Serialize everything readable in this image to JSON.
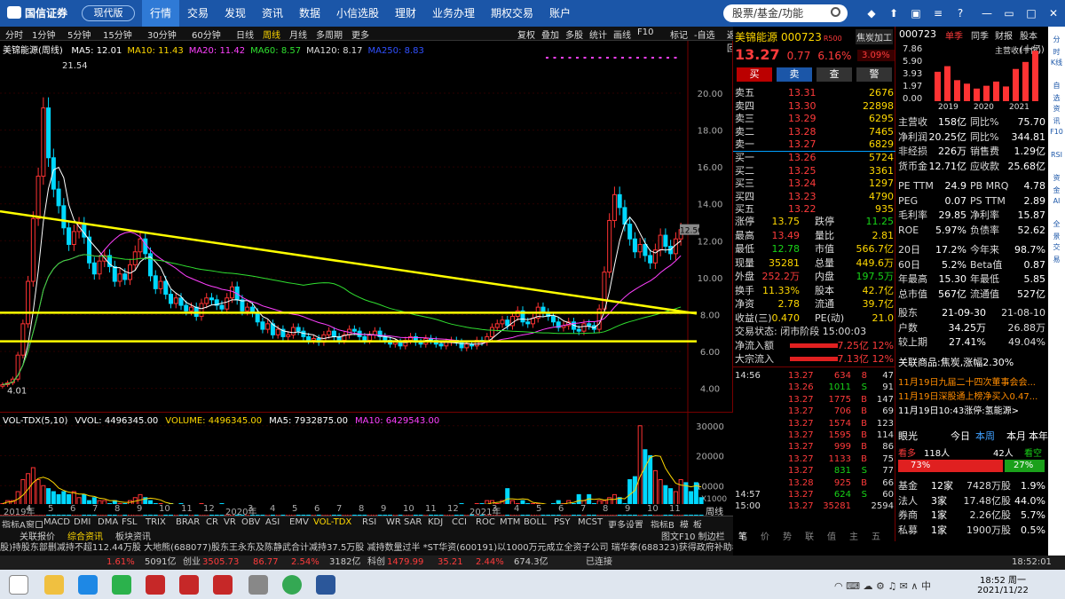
{
  "app": {
    "logo": "国信证券",
    "version_btn": "现代版",
    "search_placeholder": "股票/基金/功能"
  },
  "nav": [
    "行情",
    "交易",
    "发现",
    "资讯",
    "数据",
    "小信选股",
    "理财",
    "业务办理",
    "期权交易",
    "账户"
  ],
  "periods": [
    "分时",
    "1分钟",
    "5分钟",
    "15分钟",
    "30分钟",
    "60分钟",
    "日线",
    "周线",
    "月线",
    "多周期",
    "更多"
  ],
  "right_btns": [
    "复权",
    "叠加",
    "多股",
    "统计",
    "画线",
    "F10",
    "标记",
    "-自选",
    "返回"
  ],
  "chart": {
    "name": "美锦能源(周线)",
    "ma": [
      {
        "t": "MA5: 12.01",
        "c": "#ffffff"
      },
      {
        "t": "MA10: 11.43",
        "c": "#ffd800"
      },
      {
        "t": "MA20: 11.42",
        "c": "#ff40ff"
      },
      {
        "t": "MA60: 8.57",
        "c": "#30e030"
      },
      {
        "t": "MA120: 8.17",
        "c": "#dddddd"
      },
      {
        "t": "MA250: 8.83",
        "c": "#3050ff"
      }
    ],
    "yticks": [
      "20.00",
      "18.00",
      "16.00",
      "14.00",
      "12.00",
      "10.00",
      "8.00",
      "6.00",
      "4.00"
    ],
    "high_label": "21.54",
    "low_label": "4.01",
    "last_label": "12.56",
    "vol_legend": [
      {
        "t": "VOL-TDX(5,10)",
        "c": "#ffffff"
      },
      {
        "t": "VVOL: 4496345.00",
        "c": "#ffffff"
      },
      {
        "t": "VOLUME: 4496345.00",
        "c": "#ffd800"
      },
      {
        "t": "MA5: 7932875.00",
        "c": "#ffffff"
      },
      {
        "t": "MA10: 6429543.00",
        "c": "#ff40ff"
      }
    ],
    "vol_yticks": [
      "30000",
      "20000",
      "10000"
    ],
    "vol_unit": "X1000",
    "xlabels": [
      "2019年",
      "4",
      "5",
      "6",
      "7",
      "8",
      "9",
      "10",
      "11",
      "12",
      "2020年",
      "3",
      "4",
      "5",
      "6",
      "7",
      "8",
      "9",
      "10",
      "11",
      "12",
      "2021年",
      "3",
      "4",
      "5",
      "6",
      "7",
      "8",
      "9",
      "10",
      "11"
    ],
    "period_tag": "周线"
  },
  "chart_data": {
    "type": "candlestick",
    "title": "美锦能源(周线)",
    "ylim": [
      3.5,
      22
    ],
    "high": 21.54,
    "low": 4.01,
    "closes": [
      4.2,
      4.3,
      4.5,
      5.8,
      7.5,
      9.8,
      13.2,
      15.5,
      19.2,
      16.5,
      14.8,
      13.9,
      12.7,
      11.8,
      12.5,
      12.9,
      12.2,
      10.8,
      10.2,
      10.9,
      11.2,
      10.6,
      9.8,
      10.2,
      9.9,
      10.7,
      11.4,
      12.1,
      11.3,
      10.1,
      9.4,
      9.8,
      9.1,
      8.6,
      8.9,
      8.5,
      8.2,
      8.4,
      7.9,
      8.6,
      8.9,
      8.8,
      8.5,
      8.3,
      8.9,
      9.5,
      8.8,
      8.2,
      8.4,
      8.1,
      7.6,
      7.2,
      7.5,
      6.9,
      7.2,
      6.8,
      6.9,
      7.3,
      7.1,
      6.8,
      6.6,
      6.7,
      6.5,
      6.9,
      7.1,
      6.8,
      6.6,
      6.9,
      7.2,
      7.1,
      6.8,
      6.6,
      6.9,
      7.1,
      6.8,
      6.6,
      6.4,
      6.5,
      6.3,
      6.6,
      6.8,
      6.5,
      6.4,
      6.7,
      6.6,
      6.4,
      6.3,
      6.5,
      6.6,
      6.5,
      6.2,
      6.4,
      6.3,
      6.6,
      6.5,
      6.8,
      7.3,
      7.5,
      7.7,
      7.4,
      7.9,
      8.2,
      7.6,
      7.5,
      7.8,
      8.4,
      8.1,
      7.9,
      7.6,
      7.3,
      7.4,
      7.6,
      7.2,
      7.1,
      7.5,
      7.4,
      7.2,
      8.3,
      10.3,
      13.1,
      14.5,
      13.8,
      12.9,
      12.1,
      11.4,
      11.8,
      11.2,
      10.8,
      11.5,
      12.3,
      11.7,
      11.3,
      12.1,
      12.6
    ],
    "vols": [
      4,
      5,
      5,
      8,
      12,
      14,
      16,
      12,
      10,
      9,
      8,
      7,
      8,
      7,
      8,
      6,
      7,
      5,
      6,
      5,
      5,
      4,
      5,
      4,
      4,
      5,
      6,
      7,
      6,
      5,
      4,
      4,
      3,
      4,
      3,
      4,
      3,
      3,
      3,
      4,
      3,
      3,
      3,
      4,
      3,
      3,
      3,
      3,
      3,
      2,
      3,
      2,
      2,
      2,
      3,
      2,
      3,
      2,
      3,
      2,
      2,
      2,
      2,
      2,
      2,
      2,
      2,
      2,
      2,
      2,
      2,
      3,
      2,
      2,
      2,
      2,
      2,
      2,
      2,
      2,
      2,
      2,
      2,
      3,
      2,
      3,
      2,
      3,
      3,
      3,
      4,
      3,
      3,
      4,
      4,
      5,
      5,
      4,
      5,
      9,
      5,
      4,
      5,
      4,
      4,
      4,
      3,
      3,
      4,
      5,
      4,
      5,
      4,
      7,
      5,
      7,
      4,
      5,
      5,
      6,
      7,
      6,
      4,
      12,
      13,
      30,
      22,
      20,
      15,
      12,
      10,
      9,
      8,
      12,
      11,
      8,
      11,
      6
    ],
    "trendline": [
      [
        0,
        13.6
      ],
      [
        785,
        8.05
      ]
    ],
    "hlines": [
      8.1,
      6.55
    ]
  },
  "indicators": [
    "指标A",
    "窗口",
    "MACD",
    "DMI",
    "DMA",
    "FSL",
    "TRIX",
    "BRAR",
    "CR",
    "VR",
    "OBV",
    "ASI",
    "EMV",
    "VOL-TDX",
    "RSI",
    "WR",
    "SAR",
    "KDJ",
    "CCI",
    "ROC",
    "MTM",
    "BOLL",
    "PSY",
    "MCST",
    "更多",
    "设置"
  ],
  "ind_right": [
    "指标B",
    "模",
    "板"
  ],
  "bottom_tabs": [
    "关联报价",
    "综合资讯",
    "板块资讯"
  ],
  "bottom_right": "图文F10 制边栏",
  "ticker": "股)持股东部删减持不超112.44万股    大地熊(688077)股东王永东及陈静武合计减持37.5万股 减持数量过半    *ST华资(600191)以1000万元成立全资子公司    瑞华泰(688323)获得政府补助800万元    天马科技(603668)董事郑坤等减持448.99万股 减持数量过半",
  "status": [
    {
      "t": "1.61%",
      "c": "#ff3b3b"
    },
    {
      "t": "5091亿",
      "c": "#cccccc"
    },
    {
      "t": "创业",
      "c": "#cccccc"
    },
    {
      "t": "3505.73",
      "c": "#ff3b3b"
    },
    {
      "t": "86.77",
      "c": "#ff3b3b"
    },
    {
      "t": "2.54%",
      "c": "#ff3b3b"
    },
    {
      "t": "3182亿",
      "c": "#cccccc"
    },
    {
      "t": "科创",
      "c": "#cccccc"
    },
    {
      "t": "1479.99",
      "c": "#ff3b3b"
    },
    {
      "t": "35.21",
      "c": "#ff3b3b"
    },
    {
      "t": "2.44%",
      "c": "#ff3b3b"
    },
    {
      "t": "674.3亿",
      "c": "#cccccc"
    }
  ],
  "status_right": [
    "已连接",
    "18:52:01"
  ],
  "quote": {
    "name": "美锦能源",
    "code": "000723",
    "tag": "R500",
    "tag2": "焦炭加工",
    "tag_pct": "3.09%",
    "price": "13.27",
    "chg": "0.77",
    "pct": "6.16%",
    "buttons": [
      "买",
      "卖",
      "查",
      "警"
    ],
    "asks": [
      [
        "卖五",
        "13.31",
        "2676"
      ],
      [
        "卖四",
        "13.30",
        "22898"
      ],
      [
        "卖三",
        "13.29",
        "6295"
      ],
      [
        "卖二",
        "13.28",
        "7465"
      ],
      [
        "卖一",
        "13.27",
        "6829"
      ]
    ],
    "bids": [
      [
        "买一",
        "13.26",
        "5724"
      ],
      [
        "买二",
        "13.25",
        "3361"
      ],
      [
        "买三",
        "13.24",
        "1297"
      ],
      [
        "买四",
        "13.23",
        "4790"
      ],
      [
        "买五",
        "13.22",
        "935"
      ]
    ],
    "stats": [
      [
        "涨停",
        "13.75",
        "跌停",
        "11.25"
      ],
      [
        "最高",
        "13.49",
        "量比",
        "2.81"
      ],
      [
        "最低",
        "12.78",
        "市值",
        "566.7亿"
      ],
      [
        "现量",
        "35281",
        "总量",
        "449.6万"
      ],
      [
        "外盘",
        "252.2万",
        "内盘",
        "197.5万"
      ],
      [
        "换手",
        "11.33%",
        "股本",
        "42.7亿"
      ],
      [
        "净资",
        "2.78",
        "流通",
        "39.7亿"
      ],
      [
        "收益(三)",
        "0.470",
        "PE(动)",
        "21.0"
      ]
    ],
    "state": "交易状态: 闭市阶段 15:00:03",
    "flows": [
      [
        "净流入额",
        "7.25亿",
        "12%"
      ],
      [
        "大宗流入",
        "7.13亿",
        "12%"
      ]
    ],
    "ticks": [
      [
        "14:56",
        "13.27",
        "634",
        "8",
        "47"
      ],
      [
        "",
        "13.26",
        "1011",
        "S",
        "91"
      ],
      [
        "",
        "13.27",
        "1775",
        "B",
        "147"
      ],
      [
        "",
        "13.27",
        "706",
        "B",
        "69"
      ],
      [
        "",
        "13.27",
        "1574",
        "B",
        "123"
      ],
      [
        "",
        "13.27",
        "1595",
        "B",
        "114"
      ],
      [
        "",
        "13.27",
        "999",
        "B",
        "86"
      ],
      [
        "",
        "13.27",
        "1133",
        "B",
        "75"
      ],
      [
        "",
        "13.27",
        "831",
        "S",
        "77"
      ],
      [
        "",
        "13.28",
        "925",
        "B",
        "66"
      ],
      [
        "14:57",
        "13.27",
        "624",
        "S",
        "60"
      ],
      [
        "15:00",
        "13.27",
        "35281",
        "",
        "2594"
      ]
    ],
    "bottom_tabs": [
      "笔",
      "价",
      "势",
      "联",
      "值",
      "主",
      "五"
    ]
  },
  "f10": {
    "code": "000723",
    "tabs": [
      "单季",
      "同季",
      "财报",
      "股本(十亿)"
    ],
    "chart_title": "主营收(十亿)",
    "chart_y": [
      "7.86",
      "5.90",
      "3.93",
      "1.97",
      "0.00"
    ],
    "chart_x": [
      "2019",
      "2020",
      "2021"
    ],
    "chart_bars": [
      4.2,
      5.0,
      3.0,
      2.5,
      1.8,
      2.2,
      2.8,
      2.1,
      4.6,
      5.6,
      7.2
    ],
    "fin": [
      [
        "主营收",
        "158亿",
        "同比%",
        "75.70"
      ],
      [
        "净利润",
        "20.25亿",
        "同比%",
        "344.81"
      ],
      [
        "非经损",
        "226万",
        "销售费",
        "1.29亿"
      ],
      [
        "货币金",
        "12.71亿",
        "应收款",
        "25.68亿"
      ]
    ],
    "val": [
      [
        "PE TTM",
        "24.9",
        "PB MRQ",
        "4.78"
      ],
      [
        "PEG",
        "0.07",
        "PS TTM",
        "2.89"
      ],
      [
        "毛利率",
        "29.85",
        "净利率",
        "15.87"
      ],
      [
        "ROE",
        "5.97%",
        "负债率",
        "52.62"
      ]
    ],
    "perf": [
      [
        "20日",
        "17.2%",
        "今年来",
        "98.7%"
      ],
      [
        "60日",
        "5.2%",
        "Beta值",
        "0.87"
      ],
      [
        "年最高",
        "15.30",
        "年最低",
        "5.85"
      ],
      [
        "总市值",
        "567亿",
        "流通值",
        "527亿"
      ]
    ],
    "holders": [
      [
        "股东",
        "21-09-30",
        "21-08-10"
      ],
      [
        "户数",
        "34.25万",
        "26.88万"
      ],
      [
        "较上期",
        "27.41%",
        "49.04%"
      ]
    ],
    "related": "关联商品:焦炭,涨幅2.30%",
    "news": [
      "11月19日九届二十四次董事会会...",
      "11月19日深股通上榜净买入0.47...",
      "11月19日10:43涨停:氢能源>"
    ],
    "eyetabs": [
      "眼光",
      "今日",
      "本周",
      "本月",
      "本年"
    ],
    "sentiment": {
      "bull_label": "看多",
      "bull_n": "118人",
      "bear_n": "42人",
      "bear_label": "看空",
      "bull_pct": "73%",
      "bear_pct": "27%"
    },
    "inst": [
      [
        "基金",
        "12家",
        "7428万股",
        "1.9%"
      ],
      [
        "法人",
        "3家",
        "17.48亿股",
        "44.0%"
      ],
      [
        "券商",
        "1家",
        "2.26亿股",
        "5.7%"
      ],
      [
        "私募",
        "1家",
        "1900万股",
        "0.5%"
      ]
    ]
  },
  "sidebar": [
    "分时",
    "K线",
    "自选",
    "资讯",
    "F10",
    "RSI",
    "资金",
    "AI",
    "全景",
    "交易"
  ],
  "taskbar": {
    "time": "18:52 周一",
    "date": "2021/11/22"
  }
}
